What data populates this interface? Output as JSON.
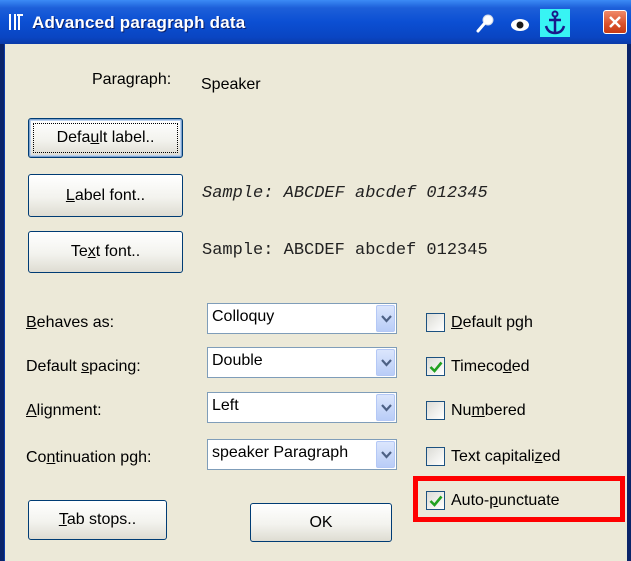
{
  "window": {
    "title": "Advanced paragraph data"
  },
  "paragraph": {
    "label": "Paragraph:",
    "value": "Speaker"
  },
  "buttons": {
    "default_label": [
      "Defa",
      "u",
      "lt label.."
    ],
    "label_font": [
      "",
      "L",
      "abel font.."
    ],
    "text_font": [
      "Te",
      "x",
      "t font.."
    ],
    "tab_stops": [
      "",
      "T",
      "ab stops.."
    ],
    "ok": "OK"
  },
  "samples": {
    "label_font": "Sample: ABCDEF abcdef 012345",
    "text_font": "Sample: ABCDEF abcdef 012345"
  },
  "fields": {
    "behaves_as": {
      "label": [
        "",
        "B",
        "ehaves as:"
      ],
      "value": "Colloquy"
    },
    "default_spacing": {
      "label": [
        "Default ",
        "s",
        "pacing:"
      ],
      "value": "Double"
    },
    "alignment": {
      "label": [
        "",
        "A",
        "lignment:"
      ],
      "value": "Left"
    },
    "continuation": {
      "label": [
        "Co",
        "n",
        "tinuation pgh:"
      ],
      "value": "speaker Paragraph"
    }
  },
  "checkboxes": [
    {
      "label": [
        "",
        "D",
        "efault pgh"
      ],
      "checked": false
    },
    {
      "label": [
        "Timeco",
        "d",
        "ed"
      ],
      "checked": true
    },
    {
      "label": [
        "Nu",
        "m",
        "bered"
      ],
      "checked": false
    },
    {
      "label": [
        "Text capitali",
        "z",
        "ed"
      ],
      "checked": false
    },
    {
      "label": [
        "Auto-",
        "p",
        "unctuate"
      ],
      "checked": true
    }
  ],
  "colors": {
    "highlight": "#ff0000",
    "title_bar": "#0b4fd3",
    "dialog_bg": "#ece9d8"
  }
}
